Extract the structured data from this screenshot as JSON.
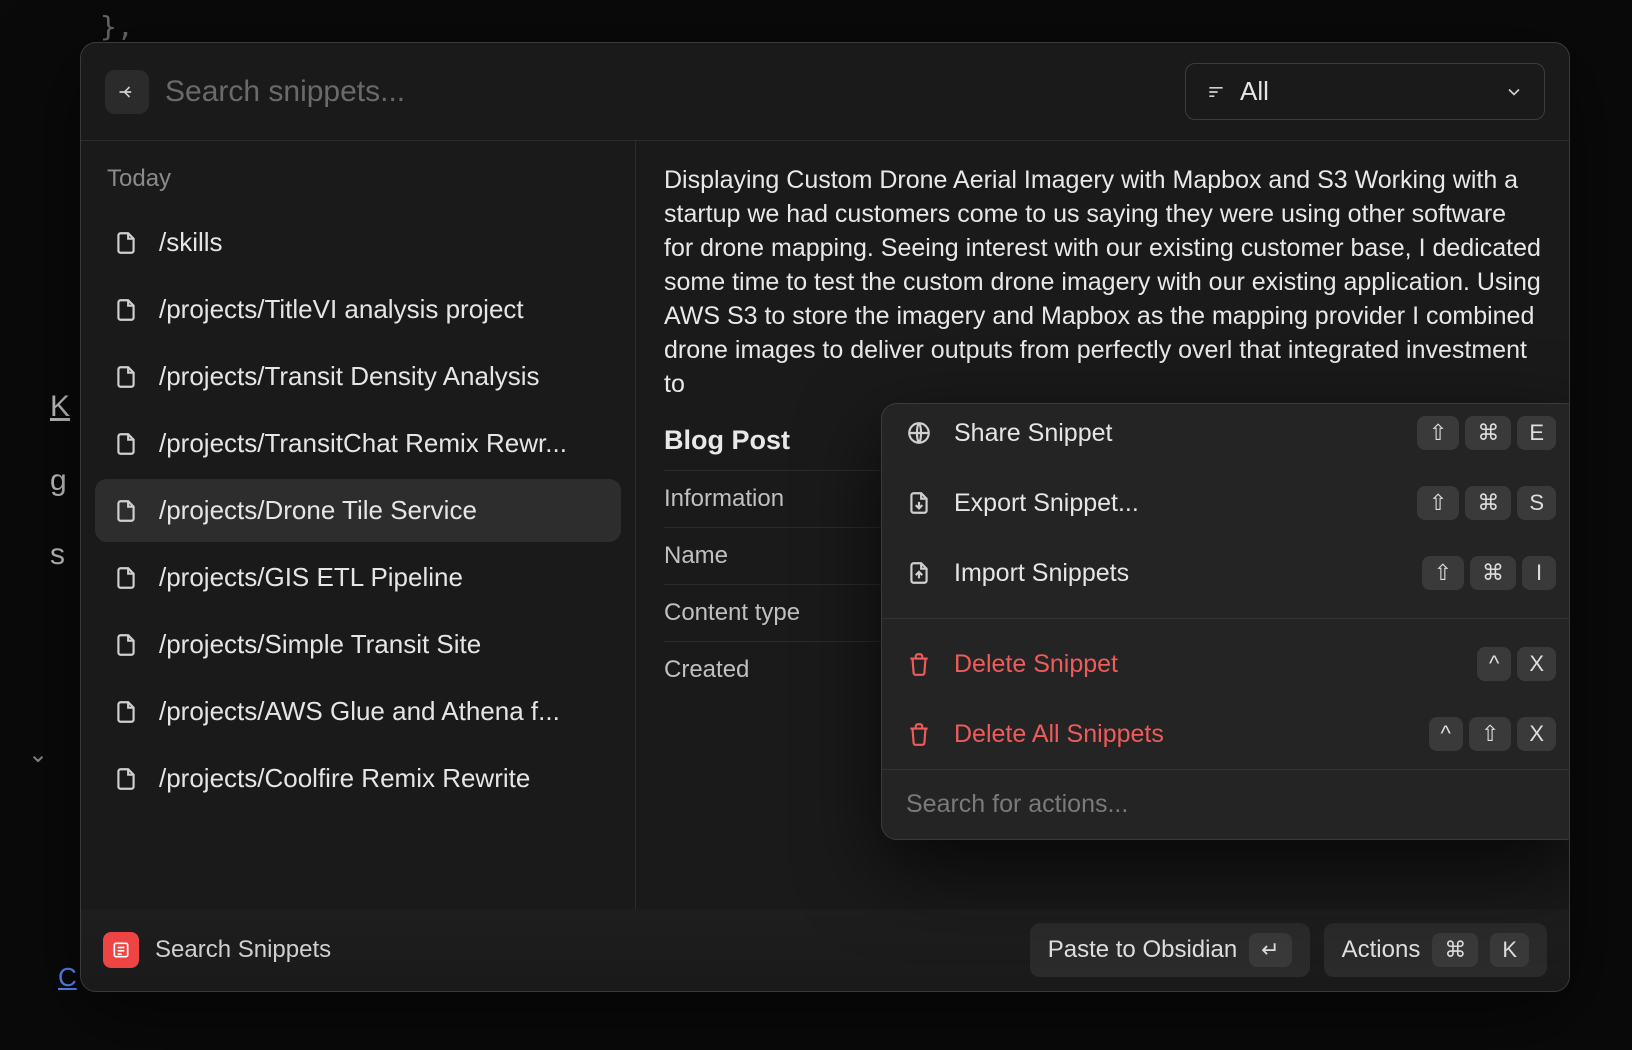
{
  "bg": {
    "code": "},",
    "k": "K",
    "g": "g",
    "s": "s",
    "link": "C"
  },
  "topbar": {
    "search_placeholder": "Search snippets...",
    "filter_label": "All"
  },
  "sidebar": {
    "section": "Today",
    "items": [
      {
        "label": "/skills"
      },
      {
        "label": "/projects/TitleVI analysis project"
      },
      {
        "label": "/projects/Transit Density Analysis"
      },
      {
        "label": "/projects/TransitChat Remix Rewr..."
      },
      {
        "label": "/projects/Drone Tile Service",
        "selected": true
      },
      {
        "label": "/projects/GIS ETL Pipeline"
      },
      {
        "label": "/projects/Simple Transit Site"
      },
      {
        "label": "/projects/AWS Glue and Athena f..."
      },
      {
        "label": "/projects/Coolfire Remix Rewrite"
      }
    ]
  },
  "detail": {
    "text": "Displaying Custom Drone Aerial Imagery with Mapbox and S3 Working with a startup we had customers come to us saying they were using other software for drone mapping. Seeing interest with our existing customer base, I dedicated some time to test the custom drone imagery with our existing application. Using AWS S3 to store the imagery and Mapbox as the mapping provider I combined drone images to deliver outputs from perfectly overl that integrated investment to",
    "meta_title": "Blog Post",
    "meta": [
      {
        "label": "Information"
      },
      {
        "label": "Name"
      },
      {
        "label": "Content type"
      },
      {
        "label": "Created"
      }
    ]
  },
  "actions": {
    "items": [
      {
        "icon": "globe",
        "label": "Share Snippet",
        "keys": [
          "⇧",
          "⌘",
          "E"
        ]
      },
      {
        "icon": "export",
        "label": "Export Snippet...",
        "keys": [
          "⇧",
          "⌘",
          "S"
        ]
      },
      {
        "icon": "import",
        "label": "Import Snippets",
        "keys": [
          "⇧",
          "⌘",
          "I"
        ]
      }
    ],
    "danger_items": [
      {
        "icon": "trash",
        "label": "Delete Snippet",
        "keys": [
          "^",
          "X"
        ]
      },
      {
        "icon": "trash",
        "label": "Delete All Snippets",
        "keys": [
          "^",
          "⇧",
          "X"
        ]
      }
    ],
    "search_placeholder": "Search for actions..."
  },
  "footer": {
    "title": "Search Snippets",
    "primary_action": "Paste to Obsidian",
    "primary_key": "↵",
    "actions_label": "Actions",
    "actions_keys": [
      "⌘",
      "K"
    ]
  }
}
